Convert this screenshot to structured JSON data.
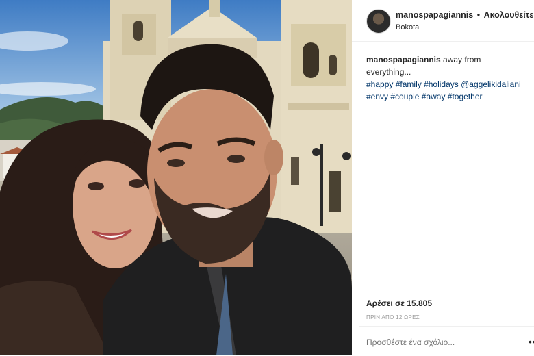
{
  "post": {
    "username": "manospapagiannis",
    "separator": "•",
    "follow_label": "Ακολουθείτε",
    "location": "Bokota",
    "caption": {
      "user": "manospapagiannis",
      "text": "away from everything...",
      "tags": [
        "#happy",
        "#family",
        "#holidays",
        "@aggelikidaliani",
        "#envy",
        "#couple",
        "#away",
        "#together"
      ]
    },
    "likes": "Αρέσει σε 15.805",
    "time": "ΠΡΙΝ ΑΠΟ 12 ΩΡΕΣ",
    "comment_placeholder": "Προσθέστε ένα σχόλιο...",
    "more_label": "•••"
  },
  "colors": {
    "text": "#262626",
    "hashtag": "#003569",
    "muted": "#999999",
    "divider": "#efefef"
  },
  "photo": {
    "description_icon": "selfie-photo"
  }
}
